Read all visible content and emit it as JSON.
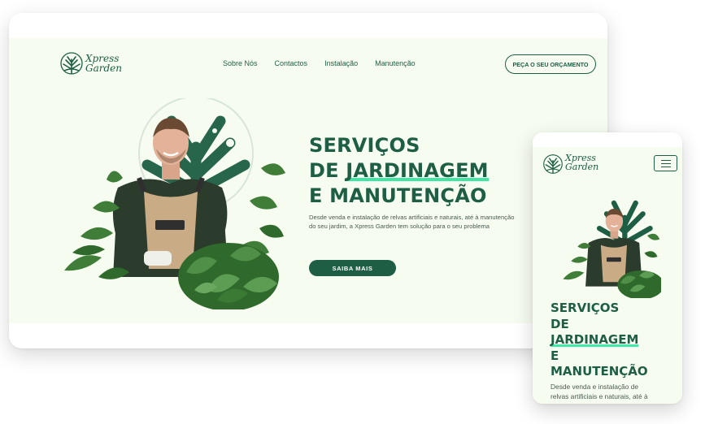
{
  "brand": {
    "line1": "Xpress",
    "line2": "Garden"
  },
  "nav": {
    "items": [
      {
        "label": "Sobre Nós"
      },
      {
        "label": "Contactos"
      },
      {
        "label": "Instalação"
      },
      {
        "label": "Manutenção"
      }
    ],
    "cta_label": "PEÇA O SEU ORÇAMENTO"
  },
  "hero": {
    "title_line1": "SERVIÇOS",
    "title_de": "DE",
    "title_highlight": "JARDINAGEM",
    "title_line3": "E MANUTENÇÃO",
    "mobile_title_e": "E",
    "mobile_title_last": "MANUTENÇÃO",
    "description": "Desde venda e instalação de relvas artificiais e naturais, até à manutenção do seu jardim, a Xpress Garden tem solução para o seu problema",
    "mobile_description": "Desde venda e instalação de relvas artificiais e naturais, até à",
    "button_label": "SAIBA MAIS"
  },
  "colors": {
    "primary": "#1d5e44",
    "highlight": "#3ee8a4",
    "background": "#f7fcf0"
  },
  "icons": {
    "logo": "tree-logo-icon",
    "menu": "hamburger-menu-icon"
  }
}
